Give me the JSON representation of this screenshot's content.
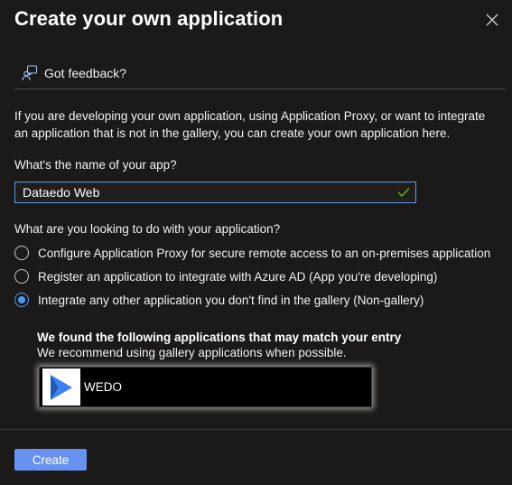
{
  "panel": {
    "title": "Create your own application",
    "close_icon": "close-icon"
  },
  "feedback": {
    "icon": "feedback-person-icon",
    "label": "Got feedback?"
  },
  "intro_text": "If you are developing your own application, using Application Proxy, or want to integrate an application that is not in the gallery, you can create your own application here.",
  "name_field": {
    "label": "What's the name of your app?",
    "value": "Dataedo Web",
    "valid_icon": "checkmark-icon"
  },
  "purpose": {
    "label": "What are you looking to do with your application?",
    "options": [
      {
        "label": "Configure Application Proxy for secure remote access to an on-premises application",
        "selected": false
      },
      {
        "label": "Register an application to integrate with Azure AD (App you're developing)",
        "selected": false
      },
      {
        "label": "Integrate any other application you don't find in the gallery (Non-gallery)",
        "selected": true
      }
    ]
  },
  "matches": {
    "heading": "We found the following applications that may match your entry",
    "subheading": "We recommend using gallery applications when possible.",
    "apps": [
      {
        "name": "WEDO",
        "logo_icon": "wedo-logo-icon",
        "logo_color": "#3b82f6"
      }
    ]
  },
  "footer": {
    "create_label": "Create"
  },
  "colors": {
    "background": "#1b1a19",
    "accent": "#4f9cf5",
    "button": "#6892f0",
    "valid": "#6bb700"
  }
}
